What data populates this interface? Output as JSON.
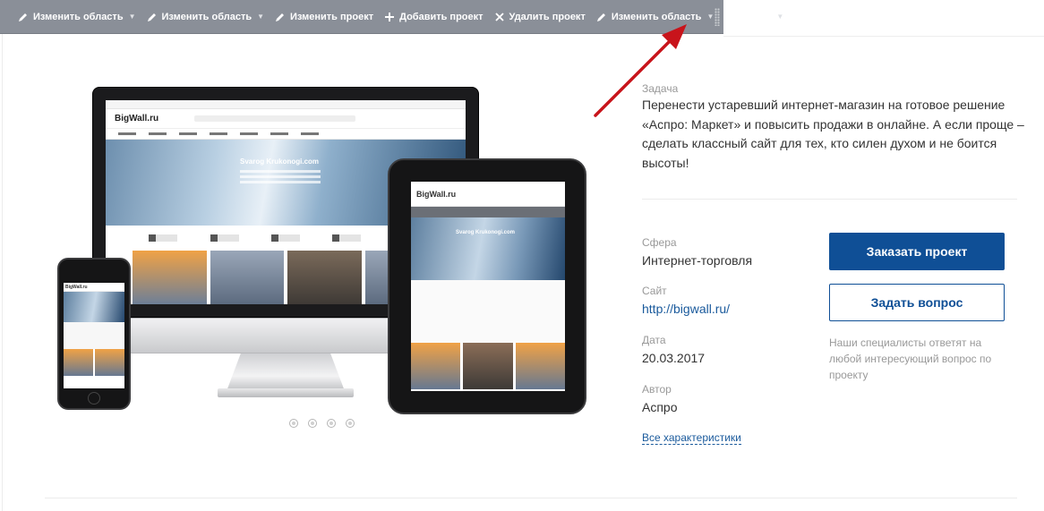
{
  "toolbar": {
    "items": [
      {
        "label": "Изменить область",
        "icon": "pencil-icon",
        "dropdown": true
      },
      {
        "label": "Изменить область",
        "icon": "pencil-icon",
        "dropdown": true
      },
      {
        "label": "Изменить проект",
        "icon": "pencil-icon",
        "dropdown": false
      },
      {
        "label": "Добавить проект",
        "icon": "plus-icon",
        "dropdown": false
      },
      {
        "label": "Удалить проект",
        "icon": "close-icon",
        "dropdown": false
      },
      {
        "label": "Изменить область",
        "icon": "pencil-icon",
        "dropdown": true
      }
    ],
    "right_icons": [
      "pin-icon",
      "gear-icon"
    ]
  },
  "mockup": {
    "site_logo": "BigWall.ru",
    "hero_title": "Svarog Krukonogi.com",
    "slider_dots": 4
  },
  "project": {
    "task_label": "Задача",
    "task_text": "Перенести устаревший интернет-магазин на готовое решение «Аспро: Маркет» и повысить продажи в онлайне. А если проще – сделать классный сайт для тех, кто силен духом и не боится высоты!",
    "sphere_label": "Сфера",
    "sphere_value": "Интернет-торговля",
    "site_label": "Сайт",
    "site_value": "http://bigwall.ru/",
    "date_label": "Дата",
    "date_value": "20.03.2017",
    "author_label": "Автор",
    "author_value": "Аспро",
    "all_specs_link": "Все характеристики"
  },
  "actions": {
    "order_button": "Заказать проект",
    "question_button": "Задать вопрос",
    "hint": "Наши специалисты ответят на любой интересующий вопрос по проекту"
  },
  "colors": {
    "toolbar_bg": "#8a8f98",
    "primary": "#0f4f96",
    "link": "#1a5a9c",
    "arrow": "#c8141b"
  }
}
